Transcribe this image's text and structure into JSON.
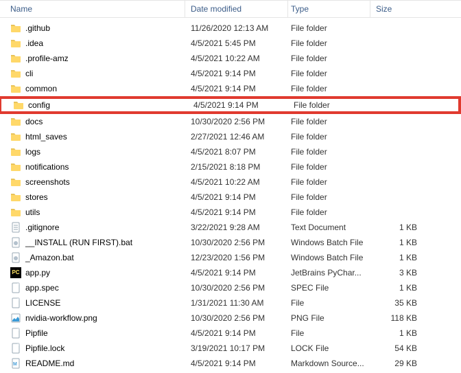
{
  "columns": {
    "name": "Name",
    "date": "Date modified",
    "type": "Type",
    "size": "Size"
  },
  "rows": [
    {
      "icon": "folder",
      "name": ".github",
      "date": "11/26/2020 12:13 AM",
      "type": "File folder",
      "size": ""
    },
    {
      "icon": "folder",
      "name": ".idea",
      "date": "4/5/2021 5:45 PM",
      "type": "File folder",
      "size": ""
    },
    {
      "icon": "folder",
      "name": ".profile-amz",
      "date": "4/5/2021 10:22 AM",
      "type": "File folder",
      "size": ""
    },
    {
      "icon": "folder",
      "name": "cli",
      "date": "4/5/2021 9:14 PM",
      "type": "File folder",
      "size": ""
    },
    {
      "icon": "folder",
      "name": "common",
      "date": "4/5/2021 9:14 PM",
      "type": "File folder",
      "size": ""
    },
    {
      "icon": "folder",
      "name": "config",
      "date": "4/5/2021 9:14 PM",
      "type": "File folder",
      "size": "",
      "highlight": true
    },
    {
      "icon": "folder",
      "name": "docs",
      "date": "10/30/2020 2:56 PM",
      "type": "File folder",
      "size": ""
    },
    {
      "icon": "folder",
      "name": "html_saves",
      "date": "2/27/2021 12:46 AM",
      "type": "File folder",
      "size": ""
    },
    {
      "icon": "folder",
      "name": "logs",
      "date": "4/5/2021 8:07 PM",
      "type": "File folder",
      "size": ""
    },
    {
      "icon": "folder",
      "name": "notifications",
      "date": "2/15/2021 8:18 PM",
      "type": "File folder",
      "size": ""
    },
    {
      "icon": "folder",
      "name": "screenshots",
      "date": "4/5/2021 10:22 AM",
      "type": "File folder",
      "size": ""
    },
    {
      "icon": "folder",
      "name": "stores",
      "date": "4/5/2021 9:14 PM",
      "type": "File folder",
      "size": ""
    },
    {
      "icon": "folder",
      "name": "utils",
      "date": "4/5/2021 9:14 PM",
      "type": "File folder",
      "size": ""
    },
    {
      "icon": "txt",
      "name": ".gitignore",
      "date": "3/22/2021 9:28 AM",
      "type": "Text Document",
      "size": "1 KB"
    },
    {
      "icon": "gear",
      "name": "__INSTALL (RUN FIRST).bat",
      "date": "10/30/2020 2:56 PM",
      "type": "Windows Batch File",
      "size": "1 KB"
    },
    {
      "icon": "gear",
      "name": "_Amazon.bat",
      "date": "12/23/2020 1:56 PM",
      "type": "Windows Batch File",
      "size": "1 KB"
    },
    {
      "icon": "pycharm",
      "name": "app.py",
      "date": "4/5/2021 9:14 PM",
      "type": "JetBrains PyChar...",
      "size": "3 KB"
    },
    {
      "icon": "file",
      "name": "app.spec",
      "date": "10/30/2020 2:56 PM",
      "type": "SPEC File",
      "size": "1 KB"
    },
    {
      "icon": "file",
      "name": "LICENSE",
      "date": "1/31/2021 11:30 AM",
      "type": "File",
      "size": "35 KB"
    },
    {
      "icon": "img",
      "name": "nvidia-workflow.png",
      "date": "10/30/2020 2:56 PM",
      "type": "PNG File",
      "size": "118 KB"
    },
    {
      "icon": "file",
      "name": "Pipfile",
      "date": "4/5/2021 9:14 PM",
      "type": "File",
      "size": "1 KB"
    },
    {
      "icon": "file",
      "name": "Pipfile.lock",
      "date": "3/19/2021 10:17 PM",
      "type": "LOCK File",
      "size": "54 KB"
    },
    {
      "icon": "md",
      "name": "README.md",
      "date": "4/5/2021 9:14 PM",
      "type": "Markdown Source...",
      "size": "29 KB"
    }
  ]
}
